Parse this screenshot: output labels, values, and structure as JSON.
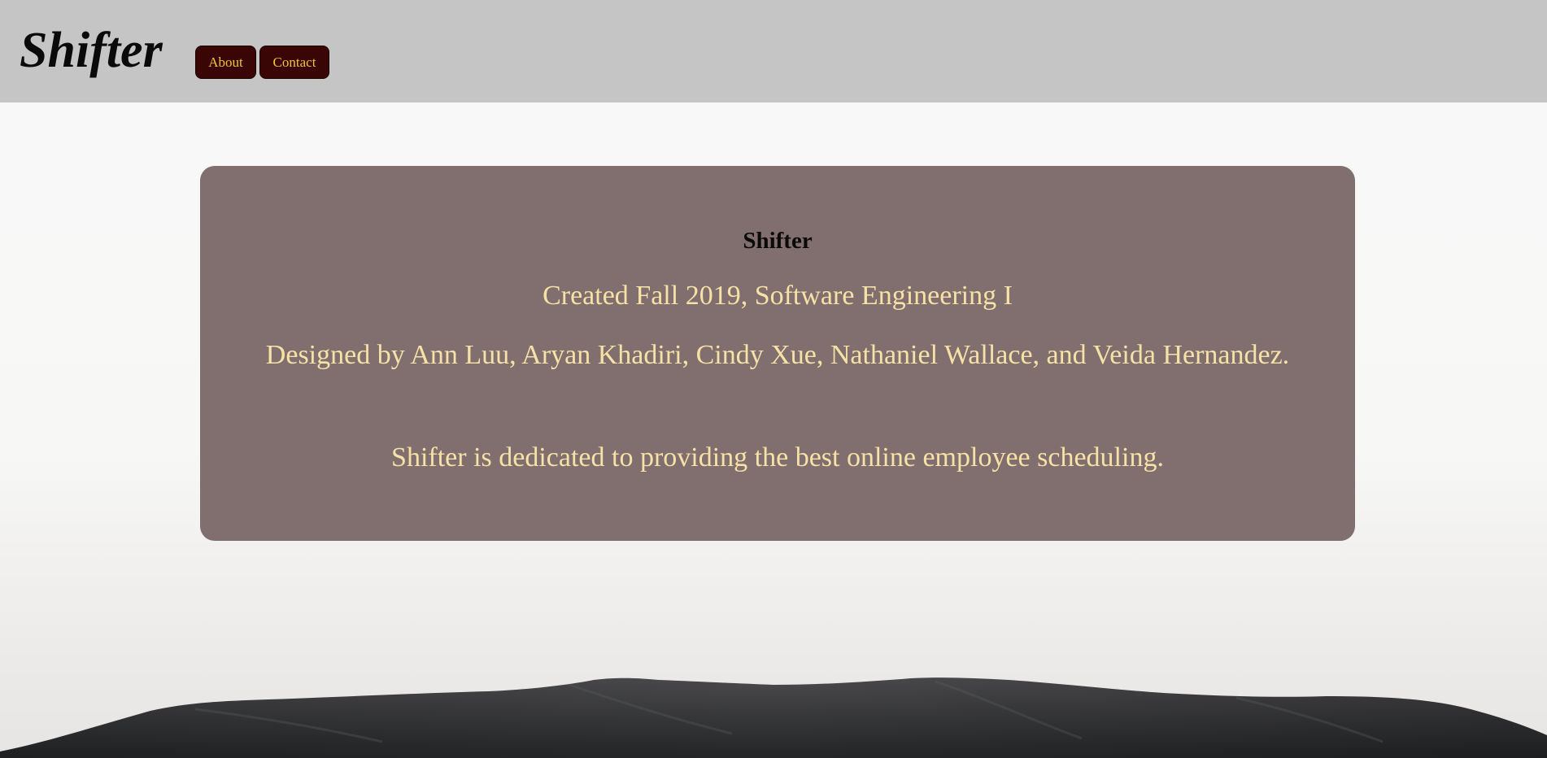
{
  "header": {
    "brand": "Shifter",
    "nav": {
      "about_label": "About",
      "contact_label": "Contact"
    }
  },
  "card": {
    "title": "Shifter",
    "created": "Created Fall 2019, Software Engineering I",
    "designed": "Designed by Ann Luu, Aryan Khadiri, Cindy Xue, Nathaniel Wallace, and Veida Hernandez.",
    "mission": "Shifter is dedicated to providing the best online employee scheduling."
  },
  "colors": {
    "header_bg": "#c5c5c5",
    "button_bg": "#3a0505",
    "button_text": "#f2c23a",
    "card_bg": "#816e6e",
    "card_text": "#f6e2a6"
  }
}
